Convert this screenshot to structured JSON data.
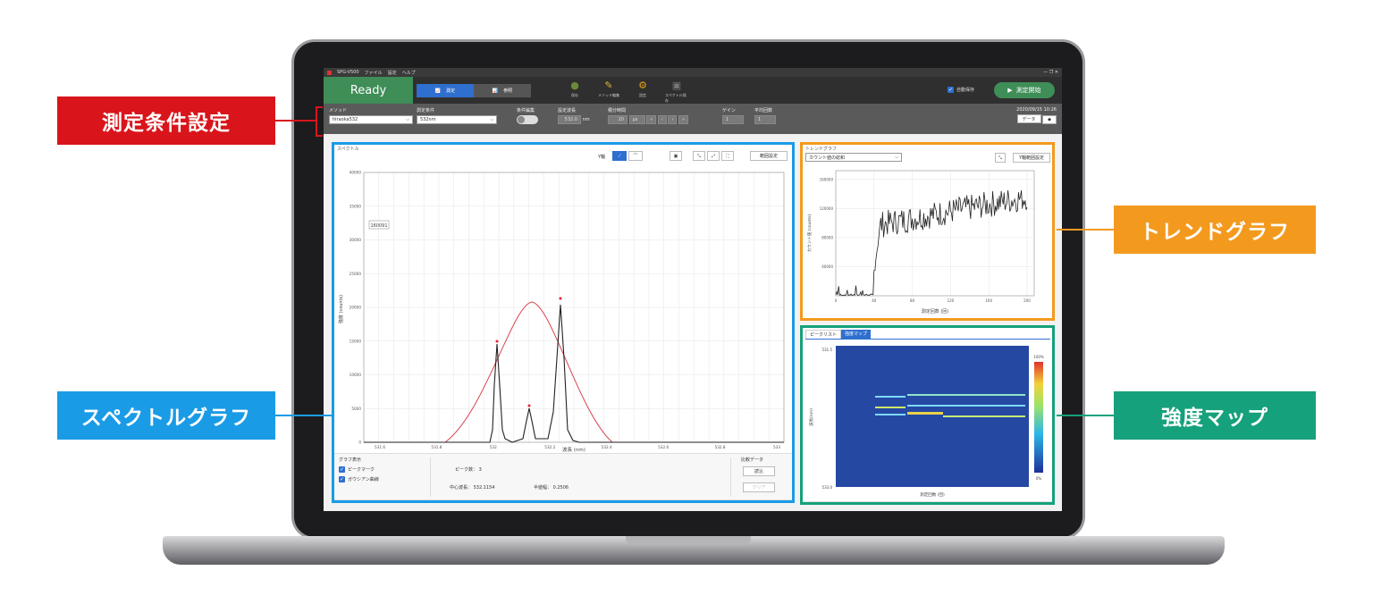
{
  "app": {
    "window_title": "SPG-V500",
    "menu": [
      "ファイル",
      "設定",
      "ヘルプ"
    ],
    "window_controls": "— ❐ ✕",
    "status": "Ready",
    "modes": [
      {
        "label": "測定",
        "active": true
      },
      {
        "label": "参照",
        "active": false
      }
    ],
    "tools": [
      "保存",
      "メソッド編集",
      "設定",
      "スペクトル保存"
    ],
    "autosave_label": "自動保存",
    "start_label": "測定開始",
    "accent_green": "#3f8d57",
    "accent_blue": "#2e6fcf"
  },
  "conditions": {
    "method_label": "メソッド",
    "method_value": "hiraoka532",
    "condition_label": "測定条件",
    "condition_value": "532nm",
    "edit_label": "条件編集",
    "wavelength_label": "設定波長",
    "wavelength_value": "532.0",
    "wavelength_unit": "nm",
    "integration_label": "積分時間",
    "integration_value": "20",
    "integration_unit": "μs",
    "gain_label": "ゲイン",
    "gain_value": "1",
    "average_label": "平均回数",
    "average_value": "1",
    "datetime": "2020/09/15 10:26",
    "data_button": "データ"
  },
  "spectrum": {
    "panel_title": "スペクトル",
    "y_axis_toggle": "Y軸",
    "range_button": "範囲設定",
    "marker_label": "160091",
    "xlabel": "波長 (nm)",
    "ylabel": "強度 (counts)",
    "x_ticks": [
      "531.6",
      "531.8",
      "532",
      "532.2",
      "532.4",
      "532.6",
      "532.8",
      "533"
    ],
    "y_ticks": [
      "0",
      "5000",
      "10000",
      "15000",
      "20000",
      "25000",
      "30000",
      "35000",
      "40000"
    ]
  },
  "graph_options": {
    "title": "グラフ表示",
    "peak_mark": "ピークマーク",
    "gaussian": "ガウシアン曲線",
    "peak_count_label": "ピーク数：",
    "peak_count": "3",
    "center_label": "中心波長：",
    "center_value": "532.1154",
    "fwhm_label": "半値幅：",
    "fwhm_value": "0.2506",
    "compare_title": "比較データ",
    "load_button": "読込",
    "clear_button": "クリア"
  },
  "trend": {
    "panel_title": "トレンドグラフ",
    "select_value": "カウント値の総和",
    "y_range_button": "Y軸範囲設定",
    "xlabel": "測定回数 (回)",
    "ylabel": "カウント値 (counts)",
    "x_ticks": [
      "0",
      "40",
      "80",
      "120",
      "160",
      "200"
    ],
    "y_ticks": [
      "40000",
      "80000",
      "120000",
      "160000"
    ]
  },
  "intensity_map": {
    "tabs": [
      {
        "label": "ピークリスト",
        "active": false
      },
      {
        "label": "強度マップ",
        "active": true
      }
    ],
    "y_top": "531.5",
    "y_bottom": "533.0",
    "ylabel": "波長(nm)",
    "xlabel": "測定回数 (回)",
    "scale_top": "100%",
    "scale_bottom": "0%"
  },
  "callouts": {
    "conditions": {
      "text": "測定条件設定",
      "color": "#d9151b"
    },
    "spectrum": {
      "text": "スペクトルグラフ",
      "color": "#1a9be6"
    },
    "trend": {
      "text": "トレンドグラフ",
      "color": "#f39a1e"
    },
    "map": {
      "text": "強度マップ",
      "color": "#15a17b"
    }
  }
}
